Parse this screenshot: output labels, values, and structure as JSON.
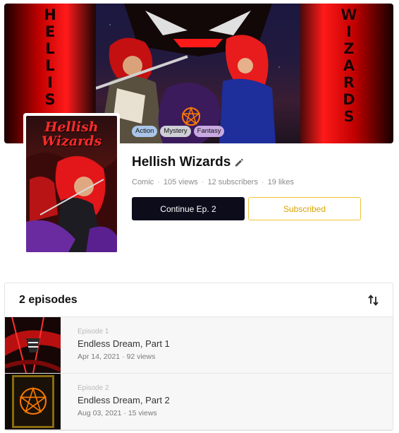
{
  "banner": {
    "left_letters": [
      "H",
      "E",
      "L",
      "L",
      "I",
      "S"
    ],
    "right_letters": [
      "W",
      "I",
      "Z",
      "A",
      "R",
      "D",
      "S"
    ],
    "tags": [
      {
        "label": "Action",
        "color": "#a9c6e8"
      },
      {
        "label": "Mystery",
        "color": "#cfcfd6"
      },
      {
        "label": "Fantasy",
        "color": "#c8a9e0"
      }
    ]
  },
  "cover": {
    "title_line1": "Hellish",
    "title_line2": "Wizards"
  },
  "series": {
    "title": "Hellish Wizards",
    "type": "Comic",
    "views": "105 views",
    "subscribers": "12 subscribers",
    "likes": "19 likes",
    "separator": "·"
  },
  "actions": {
    "continue_label": "Continue Ep. 2",
    "subscribed_label": "Subscribed"
  },
  "episodes": {
    "count_label": "2 episodes",
    "items": [
      {
        "number": "Episode 1",
        "title": "Endless Dream, Part 1",
        "date": "Apr 14, 2021",
        "views": "92 views"
      },
      {
        "number": "Episode 2",
        "title": "Endless Dream, Part 2",
        "date": "Aug 03, 2021",
        "views": "15 views"
      }
    ]
  },
  "colors": {
    "continue_bg": "#0c0c1b",
    "subscribed_accent": "#f1c232",
    "banner_red": "#e60000"
  }
}
